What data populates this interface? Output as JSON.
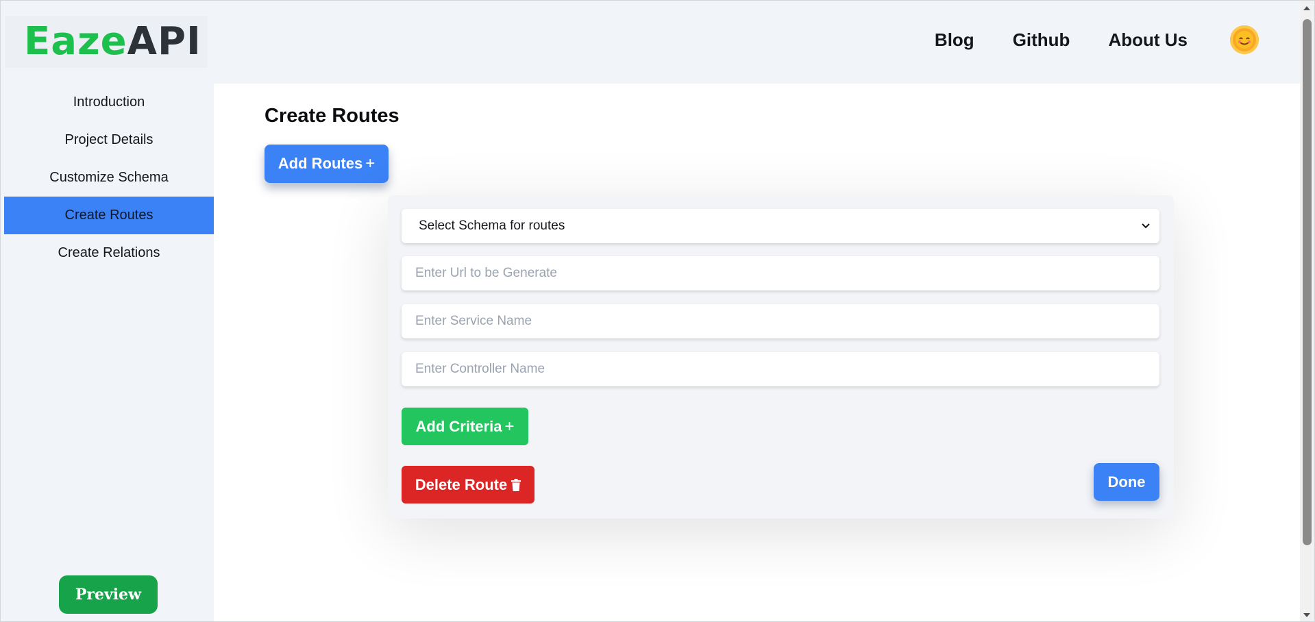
{
  "header": {
    "logo": {
      "part1": "Eaze",
      "part2": "API"
    },
    "nav": [
      "Blog",
      "Github",
      "About Us"
    ],
    "theme_icon": "sun-icon"
  },
  "sidebar": {
    "items": [
      {
        "label": "Introduction",
        "active": false
      },
      {
        "label": "Project Details",
        "active": false
      },
      {
        "label": "Customize Schema",
        "active": false
      },
      {
        "label": "Create Routes",
        "active": true
      },
      {
        "label": "Create Relations",
        "active": false
      }
    ],
    "preview_label": "Preview"
  },
  "main": {
    "title": "Create Routes",
    "add_routes_label": "Add Routes",
    "route_form": {
      "schema_select": "Select Schema for routes",
      "url_placeholder": "Enter Url to be Generate",
      "service_placeholder": "Enter Service Name",
      "controller_placeholder": "Enter Controller Name",
      "add_criteria_label": "Add Criteria",
      "delete_route_label": "Delete Route",
      "done_label": "Done"
    }
  },
  "colors": {
    "accent_blue": "#3b82f6",
    "success_green": "#22c55e",
    "danger_red": "#dc2626",
    "logo_green": "#1dbf4d",
    "preview_green": "#16a34a"
  }
}
